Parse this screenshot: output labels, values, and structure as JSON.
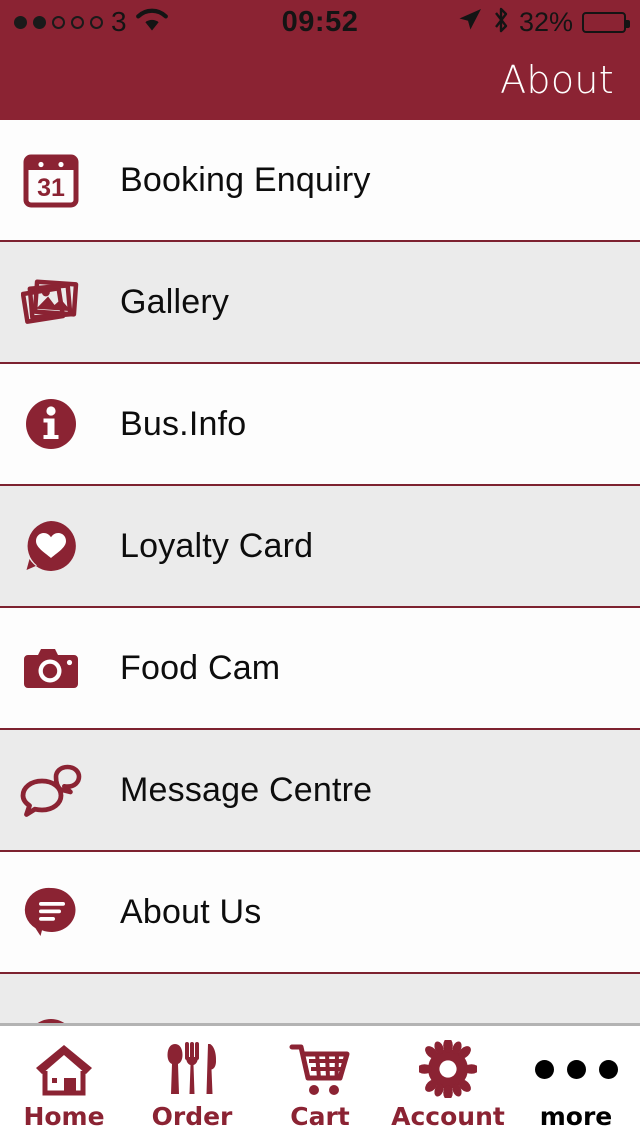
{
  "status_bar": {
    "carrier": "3",
    "signal_dots_total": 5,
    "signal_dots_filled": 2,
    "wifi_icon": "wifi-icon",
    "time": "09:52",
    "location_icon": "location-arrow-icon",
    "bluetooth_icon": "bluetooth-icon",
    "battery_percent_label": "32%",
    "battery_level": 32
  },
  "nav_bar": {
    "title": "About",
    "background_color": "#8B2333",
    "title_color": "#FFFFFF"
  },
  "theme": {
    "brand_color": "#8B2333",
    "separator_color": "#7D2230",
    "alt_row_color": "#EBEBEB",
    "row_color": "#FDFDFD",
    "label_color": "#0D0D0D"
  },
  "list": {
    "items": [
      {
        "label": "Booking Enquiry",
        "icon": "calendar-31-icon",
        "background": "white"
      },
      {
        "label": "Gallery",
        "icon": "photo-stack-icon",
        "background": "alt"
      },
      {
        "label": "Bus.Info",
        "icon": "info-circle-icon",
        "background": "white"
      },
      {
        "label": "Loyalty Card",
        "icon": "heart-pin-icon",
        "background": "alt"
      },
      {
        "label": "Food Cam",
        "icon": "camera-icon",
        "background": "white"
      },
      {
        "label": "Message Centre",
        "icon": "chat-bubbles-icon",
        "background": "alt"
      },
      {
        "label": "About Us",
        "icon": "speech-bubble-lines-icon",
        "background": "white"
      },
      {
        "label": "",
        "icon": "partial-icon",
        "background": "alt"
      }
    ]
  },
  "tab_bar": {
    "tabs": [
      {
        "label": "Home",
        "icon": "home-icon",
        "active": false
      },
      {
        "label": "Order",
        "icon": "cutlery-icon",
        "active": false
      },
      {
        "label": "Cart",
        "icon": "cart-icon",
        "active": false
      },
      {
        "label": "Account",
        "icon": "gear-icon",
        "active": false
      },
      {
        "label": "more",
        "icon": "ellipsis-icon",
        "active": true
      }
    ]
  }
}
